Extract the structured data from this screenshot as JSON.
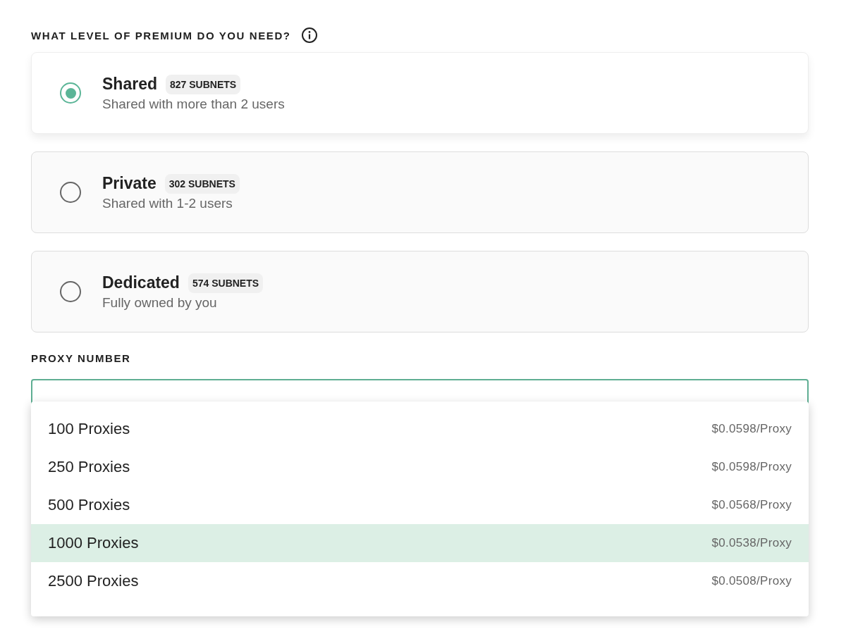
{
  "premium": {
    "heading": "WHAT LEVEL OF PREMIUM DO YOU NEED?",
    "options": [
      {
        "name": "Shared",
        "badge": "827 SUBNETS",
        "description": "Shared with more than 2 users",
        "selected": true
      },
      {
        "name": "Private",
        "badge": "302 SUBNETS",
        "description": "Shared with 1-2 users",
        "selected": false
      },
      {
        "name": "Dedicated",
        "badge": "574 SUBNETS",
        "description": "Fully owned by you",
        "selected": false
      }
    ]
  },
  "proxy_number": {
    "label": "PROXY NUMBER",
    "dropdown": [
      {
        "label": "100 Proxies",
        "price": "$0.0598/Proxy",
        "selected": false
      },
      {
        "label": "250 Proxies",
        "price": "$0.0598/Proxy",
        "selected": false
      },
      {
        "label": "500 Proxies",
        "price": "$0.0568/Proxy",
        "selected": false
      },
      {
        "label": "1000 Proxies",
        "price": "$0.0538/Proxy",
        "selected": true
      },
      {
        "label": "2500 Proxies",
        "price": "$0.0508/Proxy",
        "selected": false
      }
    ]
  }
}
